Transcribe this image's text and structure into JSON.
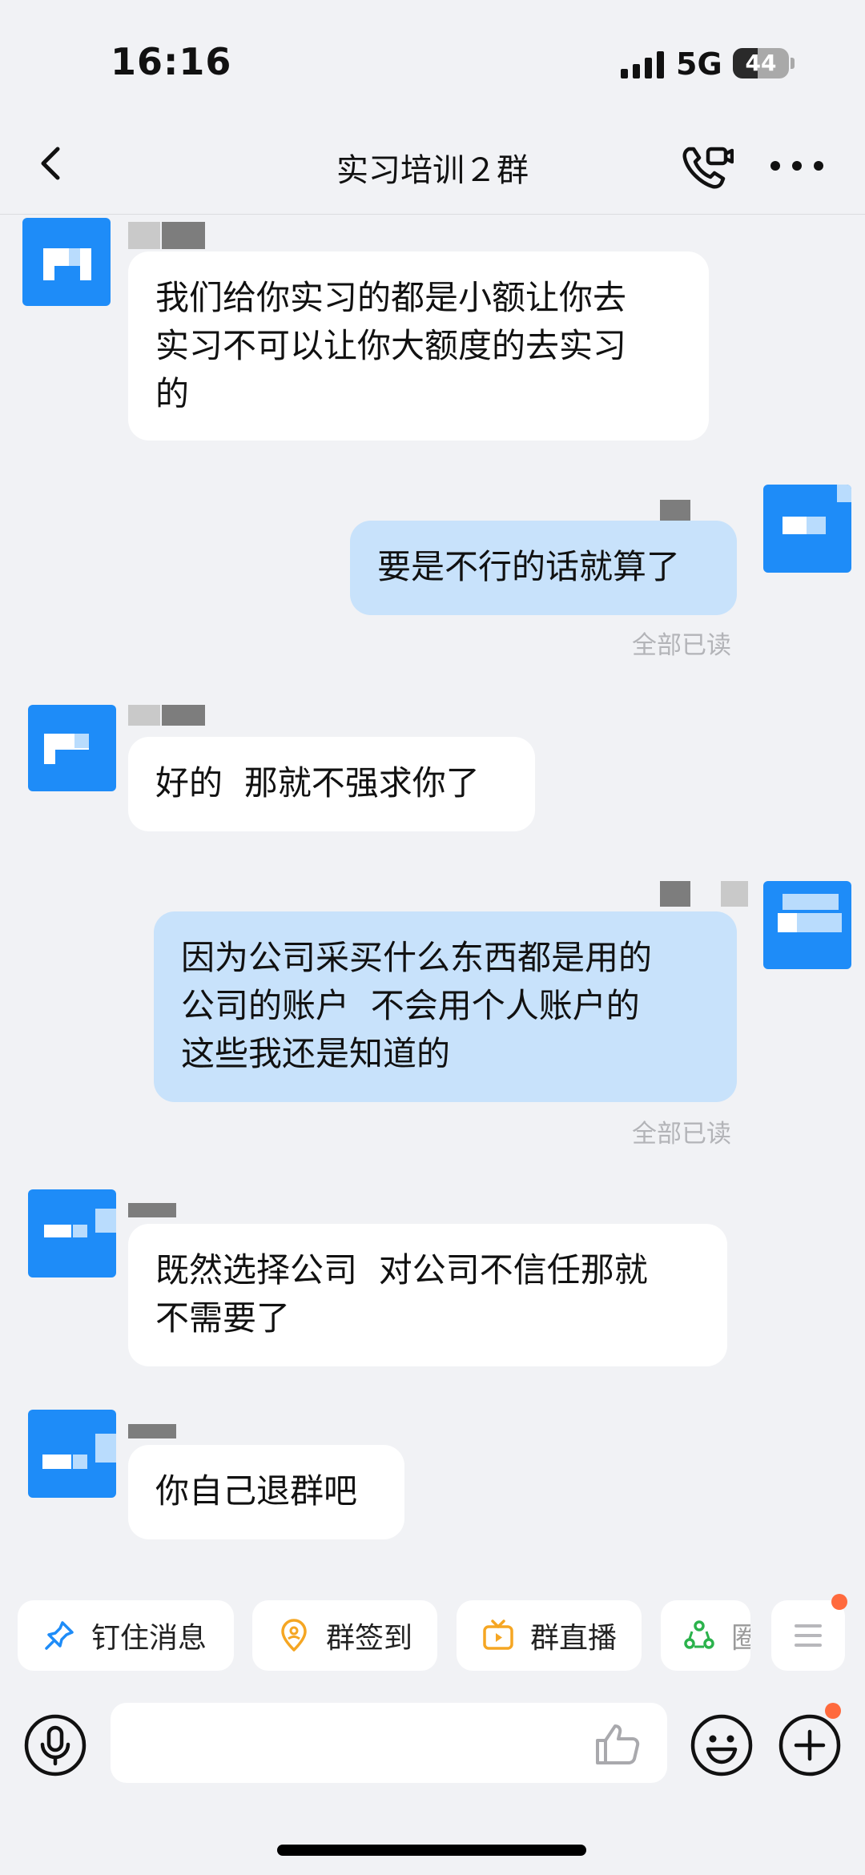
{
  "status_bar": {
    "time": "16:16",
    "network": "5G",
    "battery": "44",
    "battery_level": 0.44
  },
  "nav": {
    "title": "实习培训２群"
  },
  "messages": [
    {
      "direction": "in",
      "text": "我们给你实习的都是小额让你去\n实习不可以让你大额度的去实习\n的"
    },
    {
      "direction": "out",
      "text": "要是不行的话就算了",
      "receipt": "全部已读"
    },
    {
      "direction": "in",
      "text": "好的  那就不强求你了"
    },
    {
      "direction": "out",
      "text": "因为公司采买什么东西都是用的\n公司的账户  不会用个人账户的\n这些我还是知道的",
      "receipt": "全部已读"
    },
    {
      "direction": "in",
      "text": "既然选择公司  对公司不信任那就\n不需要了"
    },
    {
      "direction": "in",
      "text": "你自己退群吧"
    }
  ],
  "quick_actions": [
    {
      "label": "钉住消息",
      "icon": "pin-icon",
      "color": "#1e8cf8"
    },
    {
      "label": "群签到",
      "icon": "location-checkin-icon",
      "color": "#f5a623"
    },
    {
      "label": "群直播",
      "icon": "live-tv-icon",
      "color": "#f5a623"
    },
    {
      "label": "圈",
      "icon": "circle-group-icon",
      "color": "#2bb24c"
    }
  ],
  "input": {
    "placeholder": ""
  },
  "colors": {
    "accent": "#1e8cf8",
    "out_bubble": "#c8e2fb",
    "badge": "#ff6a3d"
  }
}
